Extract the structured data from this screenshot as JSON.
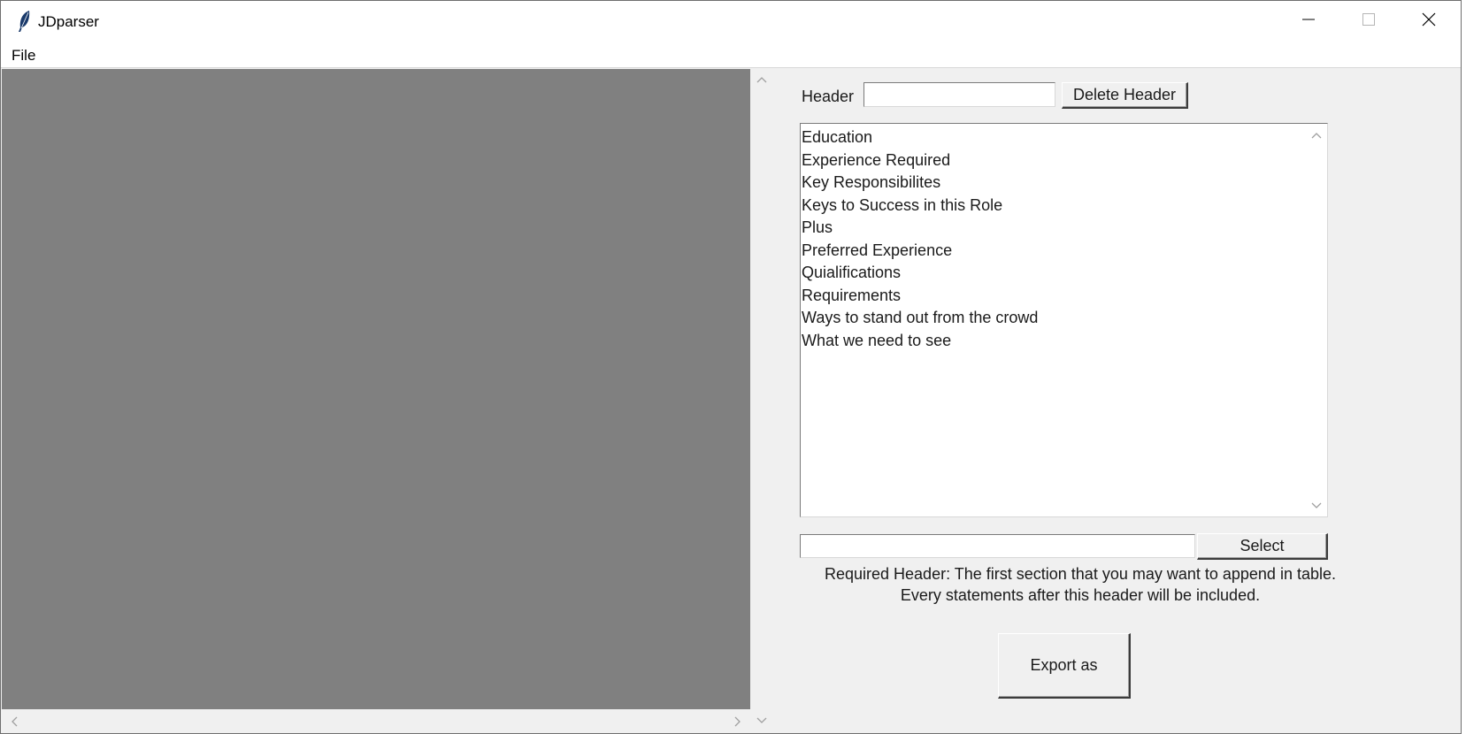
{
  "window": {
    "title": "JDparser",
    "icons": {
      "app": "feather-icon",
      "minimize": "minimize-icon",
      "maximize": "maximize-icon",
      "close": "close-icon"
    }
  },
  "menubar": {
    "items": [
      "File"
    ]
  },
  "canvas": {
    "background": "#808080"
  },
  "header_row": {
    "label": "Header",
    "input_value": "",
    "delete_button_label": "Delete Header"
  },
  "headers_list": {
    "items": [
      "Education",
      "Experience Required",
      "Key Responsibilites",
      "Keys to Success in this Role",
      "Plus",
      "Preferred Experience",
      "Quialifications",
      "Requirements",
      "Ways to stand out from the crowd",
      "What we need to see"
    ]
  },
  "select_row": {
    "input_value": "",
    "select_button_label": "Select"
  },
  "info": {
    "line1": "Required Header: The first section that you may want to append in table.",
    "line2": "Every statements after this header will be included."
  },
  "export": {
    "button_label": "Export as"
  }
}
